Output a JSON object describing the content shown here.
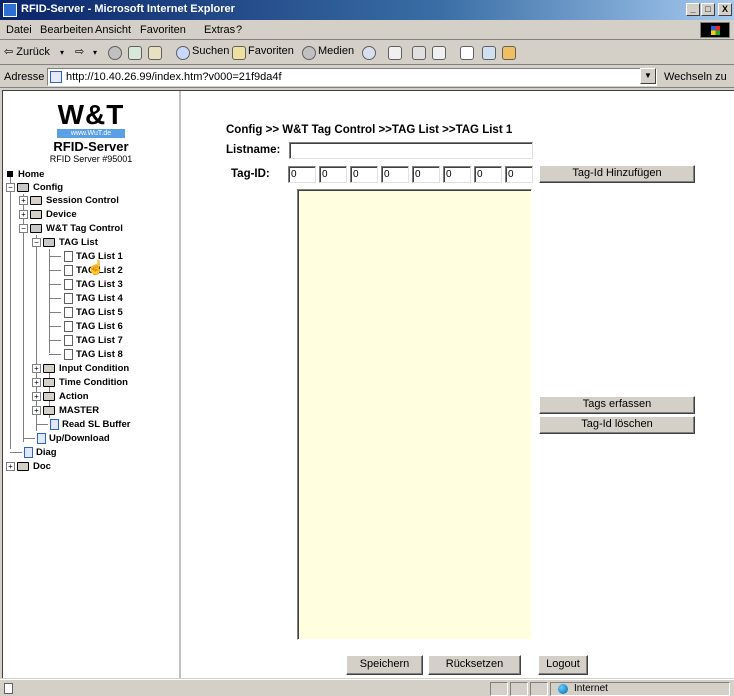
{
  "window": {
    "title": "RFID-Server - Microsoft Internet Explorer",
    "min_label": "_",
    "max_label": "□",
    "close_label": "X"
  },
  "menu": {
    "items": [
      "Datei",
      "Bearbeiten",
      "Ansicht",
      "Favoriten",
      "Extras",
      "?"
    ]
  },
  "toolbar": {
    "back": "⇦ Zurück",
    "back_arrow": "▾",
    "forward": "⇨",
    "forward_arrow": "▾",
    "search": "Suchen",
    "favorites": "Favoriten",
    "media": "Medien"
  },
  "address": {
    "label": "Adresse",
    "url": "http://10.40.26.99/index.htm?v000=21f9da4f",
    "dropdown": "▼",
    "go_label": "Wechseln zu"
  },
  "logo": {
    "brand": "W&T",
    "url": "www.WuT.de",
    "product": "RFID-Server",
    "subtitle": "RFID Server #95001"
  },
  "tree": {
    "home": "Home",
    "config": "Config",
    "session_control": "Session Control",
    "device": "Device",
    "wt_tag_control": "W&T Tag Control",
    "tag_list": "TAG List",
    "tag_lists": [
      "TAG List 1",
      "TAG List 2",
      "TAG List 3",
      "TAG List 4",
      "TAG List 5",
      "TAG List 6",
      "TAG List 7",
      "TAG List 8"
    ],
    "input_condition": "Input Condition",
    "time_condition": "Time Condition",
    "action": "Action",
    "master": "MASTER",
    "read_sl_buffer": "Read SL Buffer",
    "up_download": "Up/Download",
    "diag": "Diag",
    "doc": "Doc"
  },
  "form": {
    "breadcrumb": "Config >> W&T Tag Control >>TAG List >>TAG List  1",
    "listname_label": "Listname:",
    "listname_value": "",
    "tagid_label": "Tag-ID:",
    "tagid_values": [
      "0",
      "0",
      "0",
      "0",
      "0",
      "0",
      "0",
      "0"
    ],
    "add_button": "Tag-Id Hinzufügen",
    "capture_button": "Tags erfassen",
    "delete_button": "Tag-Id löschen",
    "save_button": "Speichern",
    "reset_button": "Rücksetzen",
    "logout_button": "Logout"
  },
  "status": {
    "zone": "Internet"
  }
}
